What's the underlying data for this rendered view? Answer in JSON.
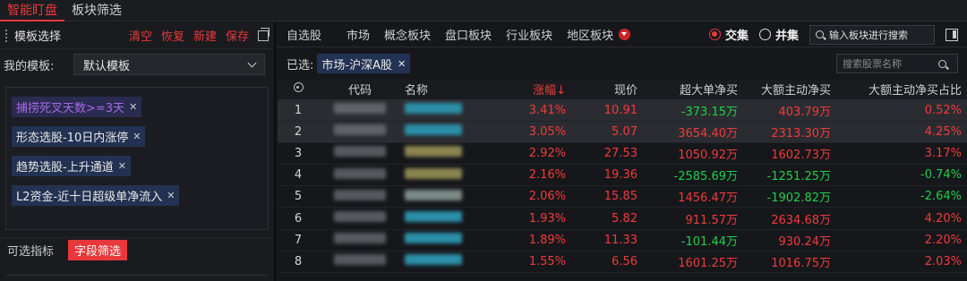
{
  "top_tabs": [
    "智能盯盘",
    "板块筛选"
  ],
  "left": {
    "title": "模板选择",
    "actions": [
      "清空",
      "恢复",
      "新建",
      "保存"
    ],
    "my_template_label": "我的模板:",
    "template_value": "默认模板",
    "tags": [
      {
        "text": "捕捞死叉天数>=3天",
        "purple": true
      },
      {
        "text": "形态选股-10日内涨停",
        "purple": false
      },
      {
        "text": "趋势选股-上升通道",
        "purple": false
      },
      {
        "text": "L2资金-近十日超级单净流入",
        "purple": false
      }
    ],
    "footer_tabs": [
      "可选指标",
      "字段筛选"
    ]
  },
  "right": {
    "categories": [
      "自选股",
      "市场",
      "概念板块",
      "盘口板块",
      "行业板块",
      "地区板块"
    ],
    "radios": [
      {
        "label": "交集",
        "on": true
      },
      {
        "label": "并集",
        "on": false
      }
    ],
    "sector_search": "输入板块进行搜索",
    "selected_label": "已选:",
    "selected_tag": "市场-沪深A股",
    "stock_search_placeholder": "搜索股票名称",
    "columns": [
      "代码",
      "名称",
      "涨幅↓",
      "现价",
      "超大单净买",
      "大额主动净买",
      "大额主动净买占比"
    ],
    "name_colors": [
      "#2c8fa8",
      "#2c8fa8",
      "#8a8550",
      "#8a8550",
      "#7a8a85",
      "#2c8fa8",
      "#2c8fa8",
      "#2c8fa8"
    ],
    "rows": [
      {
        "idx": "1",
        "change": "3.41%",
        "price": "10.91",
        "super": "-373.15万",
        "big": "403.79万",
        "ratio": "0.52%"
      },
      {
        "idx": "2",
        "change": "3.05%",
        "price": "5.07",
        "super": "3654.40万",
        "big": "2313.30万",
        "ratio": "4.25%"
      },
      {
        "idx": "3",
        "change": "2.92%",
        "price": "27.53",
        "super": "1050.92万",
        "big": "1602.73万",
        "ratio": "3.17%"
      },
      {
        "idx": "4",
        "change": "2.16%",
        "price": "19.36",
        "super": "-2585.69万",
        "big": "-1251.25万",
        "ratio": "-0.74%"
      },
      {
        "idx": "5",
        "change": "2.06%",
        "price": "15.85",
        "super": "1456.47万",
        "big": "-1902.82万",
        "ratio": "-2.64%"
      },
      {
        "idx": "6",
        "change": "1.93%",
        "price": "5.82",
        "super": "911.57万",
        "big": "2634.68万",
        "ratio": "4.20%"
      },
      {
        "idx": "7",
        "change": "1.89%",
        "price": "11.33",
        "super": "-101.44万",
        "big": "930.24万",
        "ratio": "2.20%"
      },
      {
        "idx": "8",
        "change": "1.55%",
        "price": "6.56",
        "super": "1601.25万",
        "big": "1016.75万",
        "ratio": "2.03%"
      }
    ]
  },
  "colors": {
    "accent": "#e8383b",
    "up": "#ef3b3b",
    "down": "#1fcf4a",
    "tag_bg": "#233252"
  }
}
